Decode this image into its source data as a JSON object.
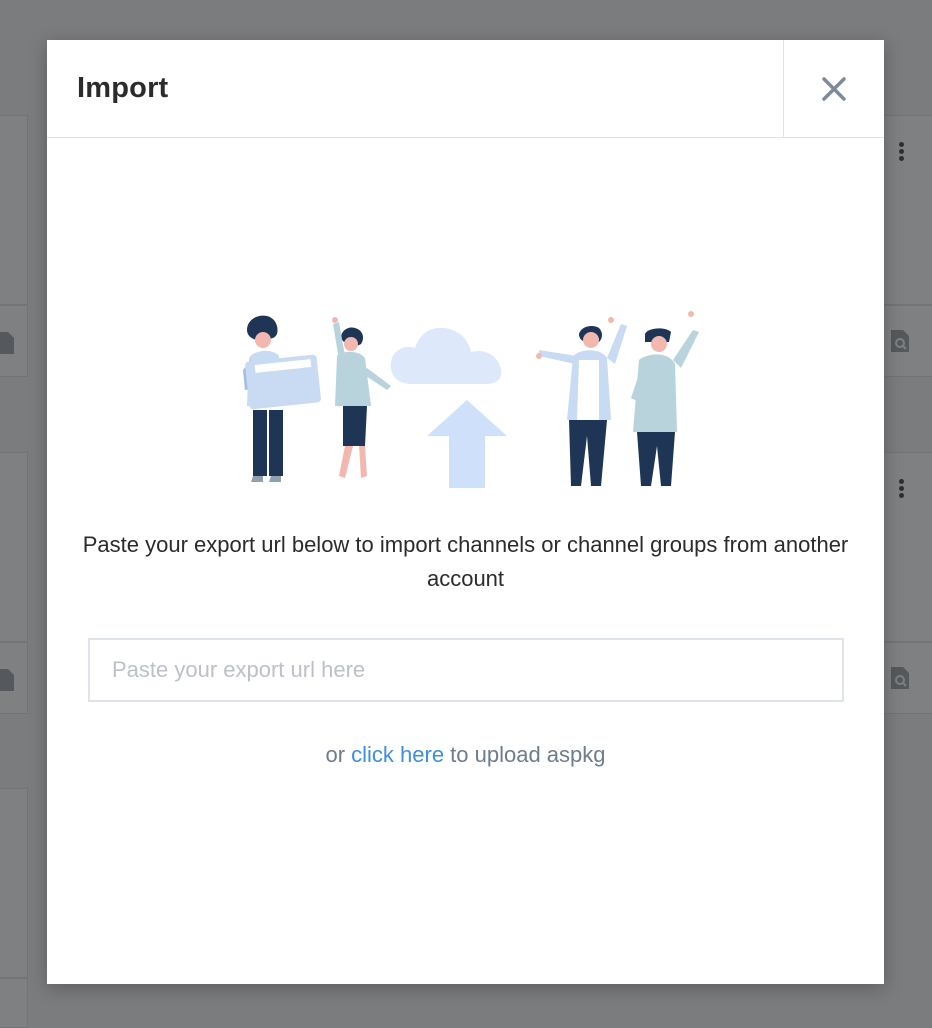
{
  "modal": {
    "title": "Import",
    "description": "Paste your export url below to import channels or channel groups from another account",
    "input_placeholder": "Paste your export url here",
    "input_value": "",
    "upload_prefix": "or ",
    "upload_link": "click here",
    "upload_suffix": " to upload aspkg"
  },
  "colors": {
    "accent_link": "#3f8ee0",
    "overlay": "#7b7c7e",
    "border": "#dfe3ec"
  },
  "icons": {
    "close": "close-icon",
    "kebab": "kebab-menu-icon",
    "document_search": "document-search-icon"
  }
}
